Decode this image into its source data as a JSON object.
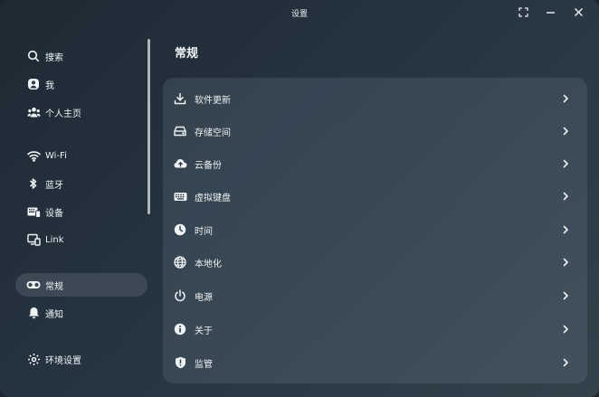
{
  "window": {
    "title": "设置",
    "controls": [
      "fullscreen-icon",
      "minimize-icon",
      "close-icon"
    ]
  },
  "sidebar": {
    "items": [
      {
        "label": "搜索",
        "icon": "search-icon"
      },
      {
        "label": "我",
        "icon": "user-icon"
      },
      {
        "label": "个人主页",
        "icon": "people-icon"
      },
      {
        "label": "Wi-Fi",
        "icon": "wifi-icon"
      },
      {
        "label": "蓝牙",
        "icon": "bluetooth-icon"
      },
      {
        "label": "设备",
        "icon": "devices-icon"
      },
      {
        "label": "Link",
        "icon": "link-icon"
      },
      {
        "label": "常规",
        "icon": "general-icon",
        "active": true
      },
      {
        "label": "通知",
        "icon": "bell-icon"
      },
      {
        "label": "环境设置",
        "icon": "settings-gear-icon"
      }
    ]
  },
  "main": {
    "title": "常规",
    "rows": [
      {
        "label": "软件更新",
        "icon": "download-icon"
      },
      {
        "label": "存储空间",
        "icon": "storage-icon"
      },
      {
        "label": "云备份",
        "icon": "cloud-backup-icon"
      },
      {
        "label": "虚拟键盘",
        "icon": "keyboard-icon"
      },
      {
        "label": "时间",
        "icon": "clock-icon"
      },
      {
        "label": "本地化",
        "icon": "globe-icon"
      },
      {
        "label": "电源",
        "icon": "power-icon"
      },
      {
        "label": "关于",
        "icon": "info-icon"
      },
      {
        "label": "监管",
        "icon": "shield-icon"
      }
    ]
  },
  "colors": {
    "background_start": "#1e2933",
    "background_end": "#34424c",
    "active_item": "#3c4853",
    "text": "#eef2f4"
  }
}
